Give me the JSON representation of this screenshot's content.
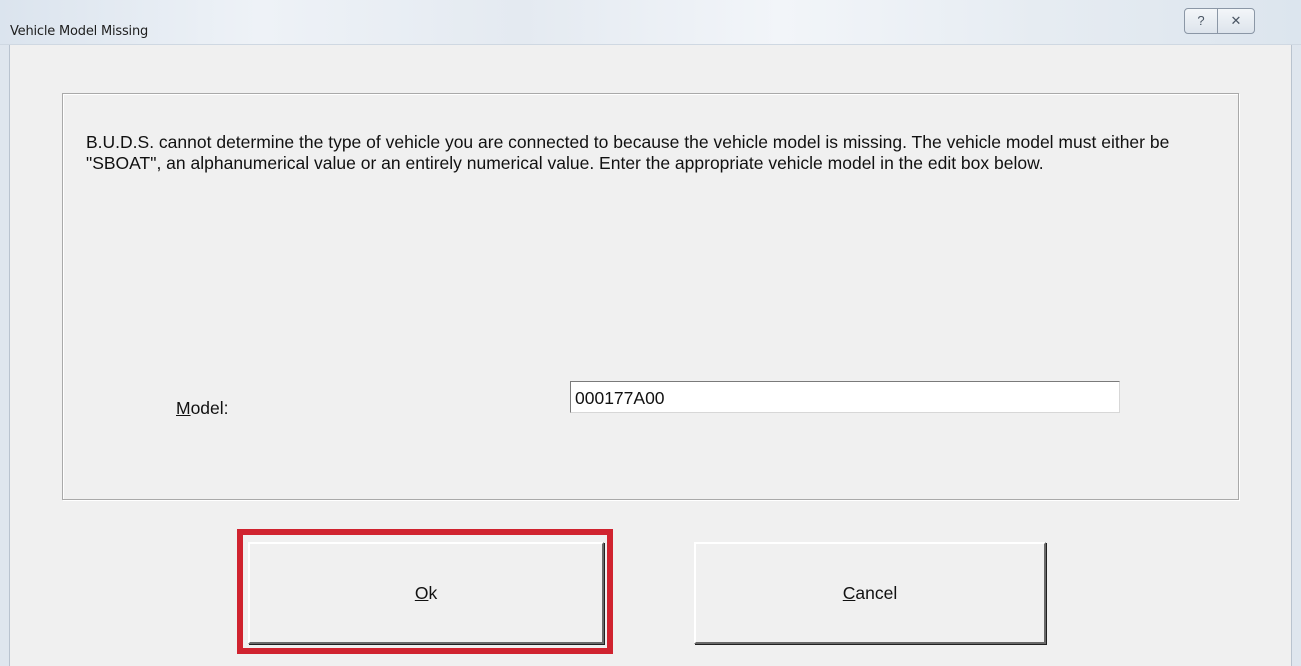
{
  "window": {
    "title": "Vehicle Model Missing",
    "help_glyph": "?",
    "close_glyph": "✕"
  },
  "message": "B.U.D.S. cannot determine the type of vehicle you are connected to because the vehicle model is missing. The vehicle model must either be \"SBOAT\", an alphanumerical value or an entirely numerical value. Enter the appropriate vehicle model in the edit box below.",
  "model": {
    "label_mnemonic": "M",
    "label_rest": "odel:",
    "value": "000177A00"
  },
  "buttons": {
    "ok_mnemonic": "O",
    "ok_rest": "k",
    "cancel_mnemonic": "C",
    "cancel_rest": "ancel"
  },
  "colors": {
    "highlight": "#d0232f",
    "dialog_background": "#f0f0f0"
  }
}
